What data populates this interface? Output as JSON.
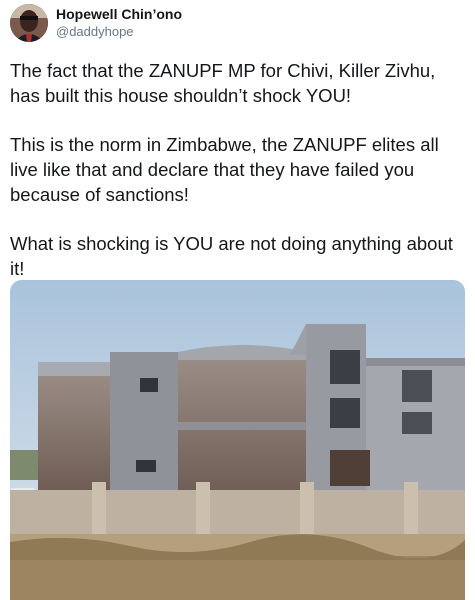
{
  "tweet": {
    "display_name": "Hopewell Chin’ono",
    "handle": "@daddyhope",
    "paragraphs": [
      "The fact that the ZANUPF MP for Chivi, Killer Zivhu, has built this house shouldn’t shock YOU!",
      "This is the norm in Zimbabwe, the ZANUPF elites all live like that and declare that they have failed you because of sanctions!",
      "What is shocking is YOU are not doing anything about it!"
    ]
  },
  "icons": {
    "avatar": "profile-photo"
  }
}
